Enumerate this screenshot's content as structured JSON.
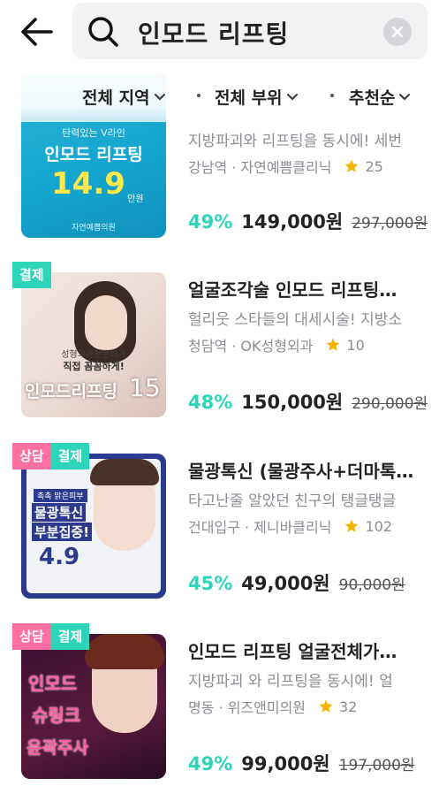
{
  "header": {
    "search_query": "인모드 리프팅"
  },
  "filters": [
    {
      "label": "전체 지역"
    },
    {
      "label": "전체 부위"
    },
    {
      "label": "추천순"
    }
  ],
  "items": [
    {
      "title": "",
      "desc": "지방파괴와 리프팅을 동시에! 세번",
      "location": "강남역 · 자연예쁨클리닉",
      "rating": "25",
      "discount": "49%",
      "price": "149,000원",
      "original": "297,000원",
      "badges": [],
      "thumb": {
        "top": "탄력있는 V라인",
        "title": "인모드 리프팅",
        "big": "14.9",
        "unit": "만원",
        "clinic": "자연예쁨의원"
      }
    },
    {
      "title": "얼굴조각술 인모드 리프팅…",
      "desc": "헐리웃 스타들의 대세시술! 지방소",
      "location": "청담역 · OK성형외과",
      "rating": "10",
      "discount": "48%",
      "price": "150,000원",
      "original": "290,000원",
      "badges": [
        "결제"
      ],
      "thumb": {
        "line1": "성형외과전문의가",
        "line2": "직접 꼼꼼하게!",
        "title": "인모드리프팅",
        "big": "15"
      }
    },
    {
      "title": "물광톡신 (물광주사+더마톡…",
      "desc": "타고난줄 알았던 친구의 탱글탱글",
      "location": "건대입구 · 제니바클리닉",
      "rating": "102",
      "discount": "45%",
      "price": "49,000원",
      "original": "90,000원",
      "badges": [
        "상담",
        "결제"
      ],
      "thumb": {
        "top": "촉촉 맑은피부",
        "line1": "물광톡신",
        "line2": "부분집중!",
        "big": "4.9"
      }
    },
    {
      "title": "인모드 리프팅 얼굴전체가…",
      "desc": "지방파괴 와 리프팅을 동시에! 얼",
      "location": "명동 · 위즈앤미의원",
      "rating": "32",
      "discount": "49%",
      "price": "99,000원",
      "original": "197,000원",
      "badges": [
        "상담",
        "결제"
      ],
      "thumb": {
        "line1": "인모드",
        "line2": "슈링크",
        "line3": "윤곽주사"
      }
    }
  ],
  "colors": {
    "accent": "#2dd4b9",
    "consult_badge": "#ff6fa1",
    "star": "#f5b400"
  },
  "icons": [
    "back-arrow-icon",
    "search-icon",
    "clear-icon",
    "chevron-down-icon",
    "star-icon"
  ]
}
